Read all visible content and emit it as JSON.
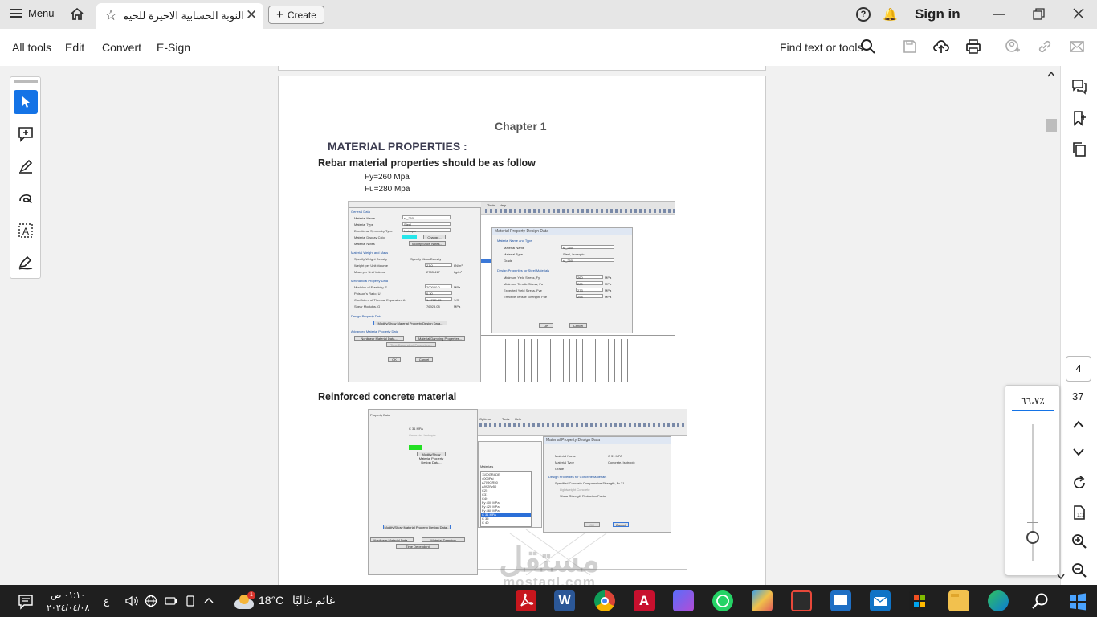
{
  "titlebar": {
    "menu_label": "Menu",
    "tab_title": "النوبة الحسابية الاخيرة للخيمة...",
    "create_label": "Create",
    "signin_label": "Sign in"
  },
  "toolbar": {
    "items": [
      "All tools",
      "Edit",
      "Convert",
      "E-Sign"
    ],
    "find_label": "Find text or tools"
  },
  "document": {
    "chapter": "Chapter 1",
    "heading": "MATERIAL PROPERTIES :",
    "rebar_heading": "Rebar material properties should be as follow",
    "fy": "Fy=260 Mpa",
    "fu": "Fu=280 Mpa",
    "rc_heading": "Reinforced concrete material",
    "shot1": {
      "menu_items": [
        "Tools",
        "Help"
      ],
      "left_title": "General Data",
      "material_name_label": "Material Name",
      "material_name": "st_260",
      "material_type_label": "Material Type",
      "material_type": "Steel",
      "symmetry_label": "Directional Symmetry Type",
      "symmetry": "Isotropic",
      "display_color_label": "Material Display Color",
      "change_btn": "Change...",
      "notes_label": "Material Notes",
      "notes_btn": "Modify/Show Notes...",
      "weight_title": "Material Weight and Mass",
      "specify_weight": "Specify Weight Density",
      "specify_mass": "Specify Mass Density",
      "weight_label": "Weight per Unit Volume",
      "weight_val": "27.0",
      "weight_unit": "kN/m³",
      "mass_label": "Mass per Unit Volume",
      "mass_val": "2753.417",
      "mass_unit": "kg/m³",
      "mech_title": "Mechanical Property Data",
      "e_label": "Modulus of Elasticity, E",
      "e_val": "200000.0",
      "e_unit": "MPa",
      "u_label": "Poisson's Ratio, U",
      "u_val": "0.30",
      "a_label": "Coefficient of Thermal Expansion, A",
      "a_val": "1.170E-05",
      "a_unit": "1/C",
      "g_label": "Shear Modulus, G",
      "g_val": "76923.08",
      "g_unit": "MPa",
      "design_title": "Design Property Data",
      "design_btn": "Modify/Show Material Property Design Data...",
      "adv_title": "Advanced Material Property Data",
      "nonlinear_btn": "Nonlinear Material Data...",
      "damping_btn": "Material Damping Properties...",
      "time_btn": "Time Dependent Properties...",
      "ok": "OK",
      "cancel": "Cancel",
      "dlg_title": "Material Property Design Data",
      "dlg_section1": "Material Name and Type",
      "dlg_name_label": "Material Name",
      "dlg_name": "st_260",
      "dlg_type_label": "Material Type",
      "dlg_type": "Steel, Isotropic",
      "dlg_grade_label": "Grade",
      "dlg_grade": "st_260",
      "dlg_section2": "Design Properties for Steel Materials",
      "fy_label": "Minimum Yield Stress, Fy",
      "fy_val": "260",
      "fu_label": "Minimum Tensile Stress, Fu",
      "fu_val": "280",
      "fye_label": "Expected Yield Stress, Fye",
      "fye_val": "273",
      "fue_label": "Effective Tensile Strength, Fue",
      "fue_val": "294",
      "unit": "MPa"
    },
    "shot2": {
      "menu_items": [
        "Options",
        "Tools",
        "Help"
      ],
      "left_title": "Property Data",
      "dlg_title": "Material Property Design Data",
      "material_name": "C 31 MPA",
      "material_type": "Concrete, Isotropic",
      "dlg_section2": "Design Properties for Concrete Materials",
      "fc_label": "Specified Concrete Compressive Strength, Fc",
      "fc_val": "31",
      "lightweight": "Lightweight Concrete",
      "shear_label": "Shear Strength Reduction Factor",
      "ok": "OK",
      "cancel": "Cancel",
      "modify_btn": "Modify/Show Material Property Design Data...",
      "nonlinear_btn": "Nonlinear Material Data...",
      "damping_btn": "Material Damping Properties...",
      "time_btn": "Time Dependent Properties...",
      "list_title": "Materials",
      "list_items": [
        "1100GRADE",
        "4000Psi",
        "A709GR50",
        "A992Fy50",
        "C25",
        "C31",
        "C40",
        "Fy 400 MPa",
        "Fy 420 MPa",
        "Fy 460 MPa",
        "C 31 MPA",
        "C 35",
        "C 40"
      ]
    }
  },
  "navigation": {
    "current_page": "4",
    "page_count": "37",
    "zoom": "٦٦،٧٪"
  },
  "taskbar": {
    "time": "٠١:١٠ ص",
    "date": "٢٠٢٤/٠٤/٠٨",
    "lang": "ع",
    "temperature": "18°C",
    "weather": "غائم غالبًا",
    "weather_badge": "1"
  },
  "watermark": {
    "text": "مستقل",
    "url": "mostaql.com"
  },
  "colors": {
    "accent": "#1473e6",
    "tab_bg": "#e6e6e6",
    "taskbar": "#1f1f1f"
  }
}
